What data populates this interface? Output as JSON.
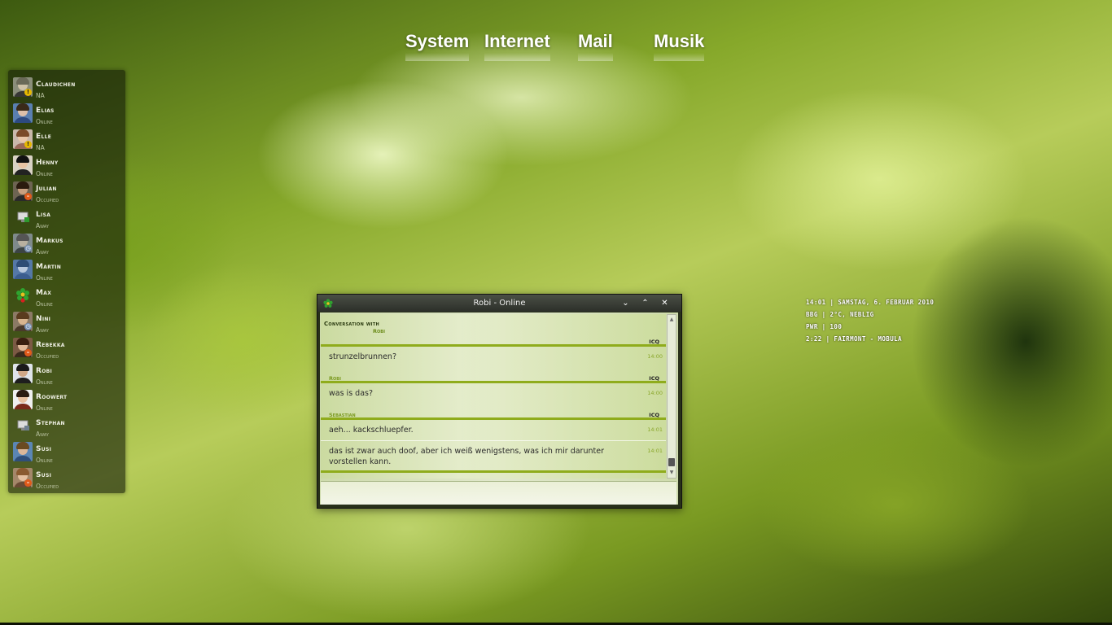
{
  "menu": {
    "items": [
      "System",
      "Internet",
      "Mail",
      "Musik"
    ]
  },
  "contacts": [
    {
      "name": "Claudichen",
      "status": "NA"
    },
    {
      "name": "Elias",
      "status": "Online"
    },
    {
      "name": "Elle",
      "status": "NA"
    },
    {
      "name": "Henny",
      "status": "Online"
    },
    {
      "name": "Julian",
      "status": "Occupied"
    },
    {
      "name": "Lisa",
      "status": "Away"
    },
    {
      "name": "Markus",
      "status": "Away"
    },
    {
      "name": "Martin",
      "status": "Online"
    },
    {
      "name": "Max",
      "status": "Online"
    },
    {
      "name": "Nini",
      "status": "Away"
    },
    {
      "name": "Rebekka",
      "status": "Occupied"
    },
    {
      "name": "Robi",
      "status": "Online"
    },
    {
      "name": "Roowert",
      "status": "Online"
    },
    {
      "name": "Stephan",
      "status": "Away"
    },
    {
      "name": "Susi",
      "status": "Online"
    },
    {
      "name": "Susi",
      "status": "Occupied"
    }
  ],
  "info": {
    "line1": "14:01 | Samstag, 6. Februar 2010",
    "line2": "BBG | 2°C, Neblig",
    "line3": "PWR | 100",
    "line4": "2:22 | Fairmont - Mobula"
  },
  "chat": {
    "title": "Robi - Online",
    "conversation_label": "Conversation with",
    "conversation_name": "Robi",
    "messages": [
      {
        "sender": "",
        "protocol": "ICQ",
        "text": "strunzelbrunnen?",
        "time": "14:00"
      },
      {
        "sender": "Robi",
        "protocol": "ICQ",
        "text": "was is das?",
        "time": "14:00"
      },
      {
        "sender": "Sebastian",
        "protocol": "ICQ",
        "text": "aeh... kackschluepfer.",
        "time": "14:01"
      },
      {
        "sender": "",
        "protocol": "",
        "text": "das ist zwar auch doof, aber ich weiß wenigstens, was ich mir darunter vorstellen kann.",
        "time": "14:01"
      }
    ]
  },
  "colors": {
    "accent_green": "#8fac1c",
    "panel_dark": "#1c2408"
  },
  "icons": {
    "chat_app": "icq-flower-icon",
    "minimize": "chevron-down-icon",
    "maximize": "chevron-up-icon",
    "close": "close-icon"
  }
}
